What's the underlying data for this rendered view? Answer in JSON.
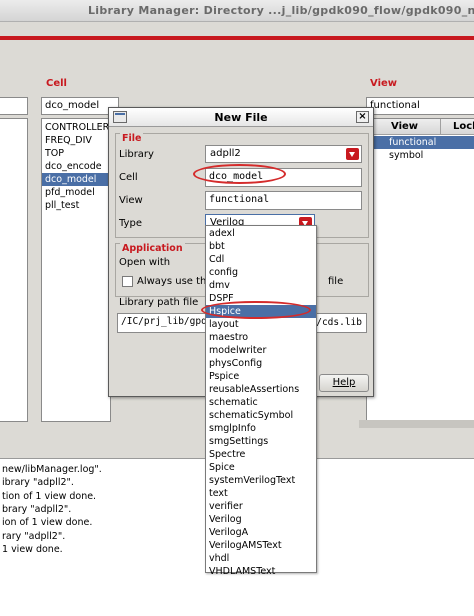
{
  "window": {
    "title": "Library Manager: Directory ...j_lib/gpdk090_flow/gpdk090_nev"
  },
  "cell_panel": {
    "header": "Cell",
    "filter_value": "dco_model",
    "items": [
      "CONTROLLER",
      "FREQ_DIV",
      "TOP",
      "dco_encode",
      "dco_model",
      "pfd_model",
      "pll_test"
    ],
    "selected_index": 4
  },
  "view_panel": {
    "header": "View",
    "filter_value": "functional",
    "columns": [
      "View",
      "Lock"
    ],
    "items": [
      "functional",
      "symbol"
    ],
    "selected_index": 0
  },
  "dialog": {
    "title": "New File",
    "file_group": {
      "label": "File",
      "library_label": "Library",
      "library_value": "adpll2",
      "cell_label": "Cell",
      "cell_value": "dco_model",
      "view_label": "View",
      "view_value": "functional",
      "type_label": "Type",
      "type_value": "Verilog"
    },
    "application_group": {
      "label": "Application",
      "open_with_label": "Open with",
      "always_use_label": "Always use this",
      "always_use_suffix": "file"
    },
    "library_path_label": "Library path file",
    "library_path_value_left": "/IC/prj_lib/gpdk",
    "library_path_value_right": "w/cds.lib",
    "help_label": "Help"
  },
  "type_dropdown": {
    "options": [
      "adexl",
      "bbt",
      "Cdl",
      "config",
      "dmv",
      "DSPF",
      "Hspice",
      "layout",
      "maestro",
      "modelwriter",
      "physConfig",
      "Pspice",
      "reusableAssertions",
      "schematic",
      "schematicSymbol",
      "smglpInfo",
      "smgSettings",
      "Spectre",
      "Spice",
      "systemVerilogText",
      "text",
      "verifier",
      "Verilog",
      "VerilogA",
      "VerilogAMSText",
      "vhdl",
      "VHDLAMSText"
    ],
    "highlighted_index": 6
  },
  "console": {
    "lines": [
      "new/libManager.log\".",
      "ibrary \"adpll2\".",
      "tion of 1 view done.",
      "brary \"adpll2\".",
      "ion of 1 view done.",
      "rary \"adpll2\".",
      "1 view done."
    ]
  },
  "colors": {
    "accent": "#c8191f",
    "selection": "#4a6fa6",
    "annotation": "#d42b2b"
  }
}
